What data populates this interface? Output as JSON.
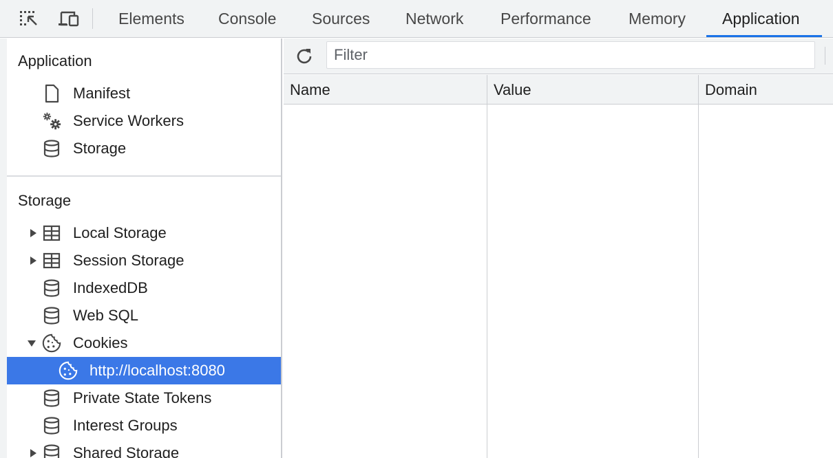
{
  "tabs": [
    {
      "label": "Elements"
    },
    {
      "label": "Console"
    },
    {
      "label": "Sources"
    },
    {
      "label": "Network"
    },
    {
      "label": "Performance"
    },
    {
      "label": "Memory"
    },
    {
      "label": "Application"
    }
  ],
  "active_tab": "Application",
  "sidebar": {
    "application_section": {
      "title": "Application",
      "items": [
        {
          "label": "Manifest",
          "icon": "document-icon"
        },
        {
          "label": "Service Workers",
          "icon": "gears-icon"
        },
        {
          "label": "Storage",
          "icon": "database-icon"
        }
      ]
    },
    "storage_section": {
      "title": "Storage",
      "items": [
        {
          "label": "Local Storage",
          "icon": "table-icon",
          "expandable": "collapsed"
        },
        {
          "label": "Session Storage",
          "icon": "table-icon",
          "expandable": "collapsed"
        },
        {
          "label": "IndexedDB",
          "icon": "database-icon"
        },
        {
          "label": "Web SQL",
          "icon": "database-icon"
        },
        {
          "label": "Cookies",
          "icon": "cookie-icon",
          "expandable": "expanded"
        },
        {
          "label": "http://localhost:8080",
          "icon": "cookie-icon",
          "selected": true
        },
        {
          "label": "Private State Tokens",
          "icon": "database-icon"
        },
        {
          "label": "Interest Groups",
          "icon": "database-icon"
        },
        {
          "label": "Shared Storage",
          "icon": "database-icon",
          "expandable": "collapsed"
        }
      ]
    }
  },
  "toolbar": {
    "filter_placeholder": "Filter"
  },
  "table": {
    "columns": [
      "Name",
      "Value",
      "Domain"
    ],
    "rows": []
  },
  "colors": {
    "selection": "#3b78e7",
    "tab_underline": "#1a73e8",
    "toolbar_bg": "#f1f3f4"
  }
}
